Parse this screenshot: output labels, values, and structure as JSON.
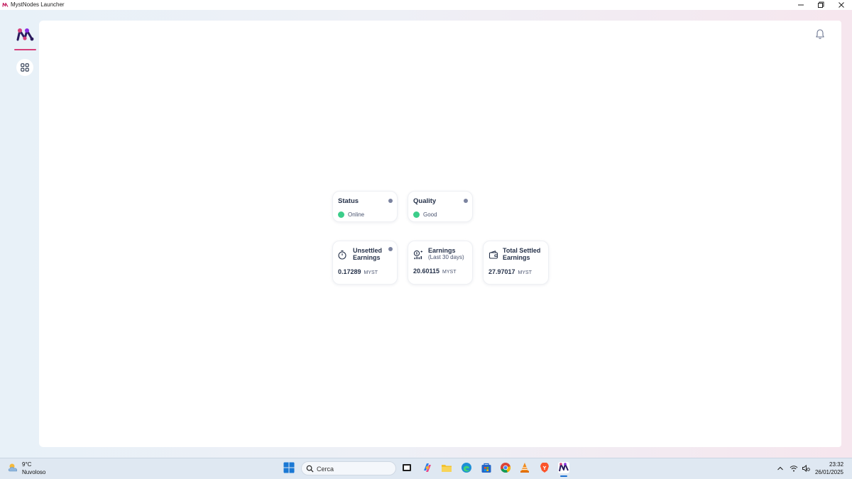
{
  "window": {
    "title": "MystNodes Launcher",
    "controls": [
      "minimize-icon",
      "restore-icon",
      "close-icon"
    ]
  },
  "sidebar": {
    "logo": "mystnodes-logo",
    "items": [
      {
        "icon": "dashboard-grid-icon",
        "active": true
      }
    ]
  },
  "header": {
    "notifications_icon": "bell-icon"
  },
  "status_cards": [
    {
      "title": "Status",
      "value": "Online",
      "status_color": "#3ccd8a"
    },
    {
      "title": "Quality",
      "value": "Good",
      "status_color": "#3ccd8a"
    }
  ],
  "earnings_cards": [
    {
      "icon": "stopwatch-icon",
      "title_line1": "Unsettled",
      "title_line2": "Earnings",
      "value": "0.17289",
      "unit": "MYST"
    },
    {
      "icon": "coins-chart-icon",
      "title_line1": "Earnings",
      "title_line2": "(Last 30 days)",
      "value": "20.60115",
      "unit": "MYST"
    },
    {
      "icon": "wallet-icon",
      "title_line1": "Total Settled",
      "title_line2": "Earnings",
      "value": "27.97017",
      "unit": "MYST"
    }
  ],
  "taskbar": {
    "weather": {
      "temp": "9°C",
      "desc": "Nuvoloso"
    },
    "search_placeholder": "Cerca",
    "clock": {
      "time": "23:32",
      "date": "26/01/2025"
    }
  },
  "colors": {
    "accent": "#d6407c",
    "online": "#3ccd8a",
    "taskbar": "#dfe8f2"
  }
}
